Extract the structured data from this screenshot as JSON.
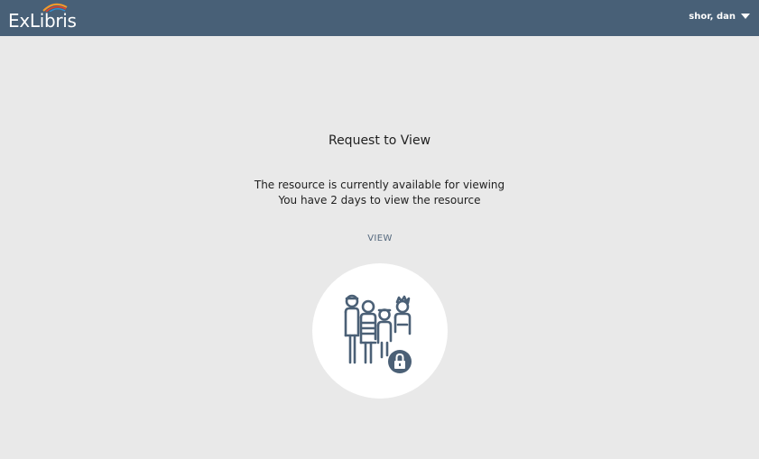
{
  "header": {
    "logo_text": "ExLibris",
    "user_name": "shor, dan",
    "colors": {
      "bar": "#486077",
      "arc_orange": "#f39a2a",
      "arc_red": "#e4412b",
      "arc_blue": "#2f8fd0"
    }
  },
  "main": {
    "title": "Request to View",
    "message_line1": "The resource is currently available for viewing",
    "message_line2": "You have 2 days to view the resource",
    "view_label": "VIEW",
    "illustration_icon": "people-lock-icon",
    "icon_color": "#4b6076"
  }
}
